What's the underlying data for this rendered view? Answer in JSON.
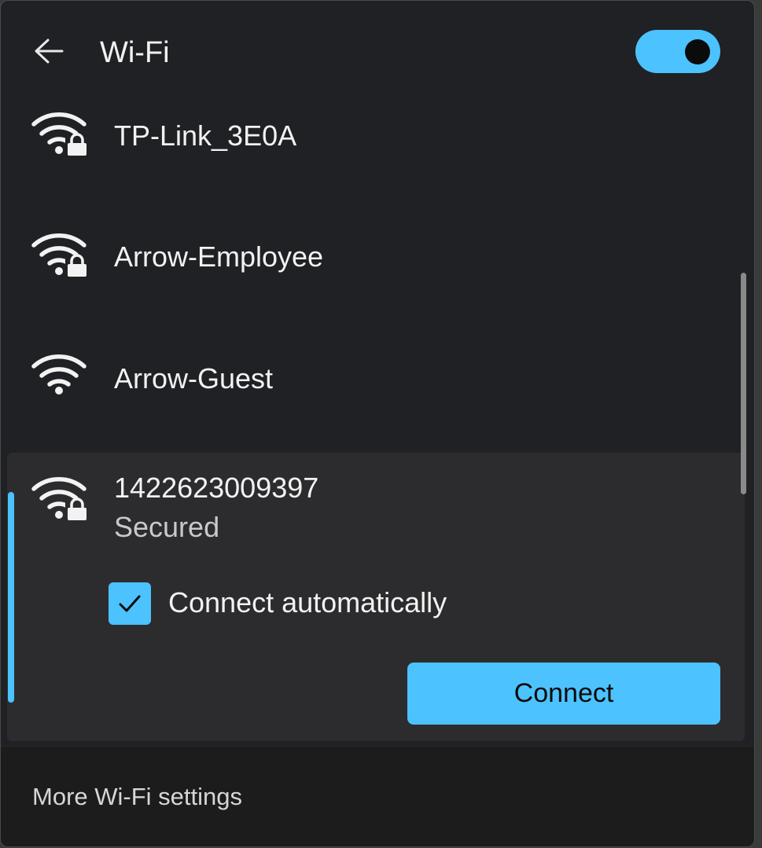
{
  "colors": {
    "accent": "#4cc2ff",
    "panel_bg": "#202124",
    "selected_bg": "#2c2c2e",
    "footer_bg": "#1c1c1c",
    "text_primary": "#f2f2f2",
    "text_secondary": "#c9c9c9"
  },
  "header": {
    "back_icon": "arrow-left-icon",
    "title": "Wi-Fi",
    "toggle_state": "on"
  },
  "networks": [
    {
      "name": "TP-Link_3E0A",
      "icon": "wifi-locked-icon",
      "secured": true
    },
    {
      "name": "Arrow-Employee",
      "icon": "wifi-locked-icon",
      "secured": true
    },
    {
      "name": "Arrow-Guest",
      "icon": "wifi-icon",
      "secured": false
    },
    {
      "name": "1422623009397",
      "icon": "wifi-locked-icon",
      "secured": true,
      "expanded": true,
      "status": "Secured",
      "connect_automatically_label": "Connect automatically",
      "connect_automatically_checked": true,
      "connect_button_label": "Connect"
    }
  ],
  "footer": {
    "more_settings_label": "More Wi-Fi settings"
  }
}
